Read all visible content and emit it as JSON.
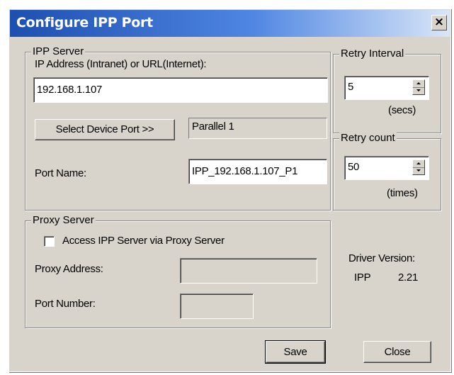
{
  "window": {
    "title": "Configure IPP Port",
    "close_label": "×"
  },
  "ipp_server": {
    "legend": "IPP Server",
    "address_label": "IP Address (Intranet) or URL(Internet):",
    "address_value": "192.168.1.107",
    "select_port_button": "Select Device Port >>",
    "device_port_value": "Parallel 1",
    "port_name_label": "Port Name:",
    "port_name_value": "IPP_192.168.1.107_P1"
  },
  "retry_interval": {
    "legend": "Retry Interval",
    "value": "5",
    "unit": "(secs)"
  },
  "retry_count": {
    "legend": "Retry count",
    "value": "50",
    "unit": "(times)"
  },
  "proxy_server": {
    "legend": "Proxy Server",
    "checkbox_label": "Access IPP Server via Proxy Server",
    "checkbox_checked": false,
    "address_label": "Proxy Address:",
    "address_value": "",
    "port_label": "Port Number:",
    "port_value": ""
  },
  "driver": {
    "label": "Driver Version:",
    "name": "IPP",
    "version": "2.21"
  },
  "buttons": {
    "save": "Save",
    "close": "Close"
  }
}
